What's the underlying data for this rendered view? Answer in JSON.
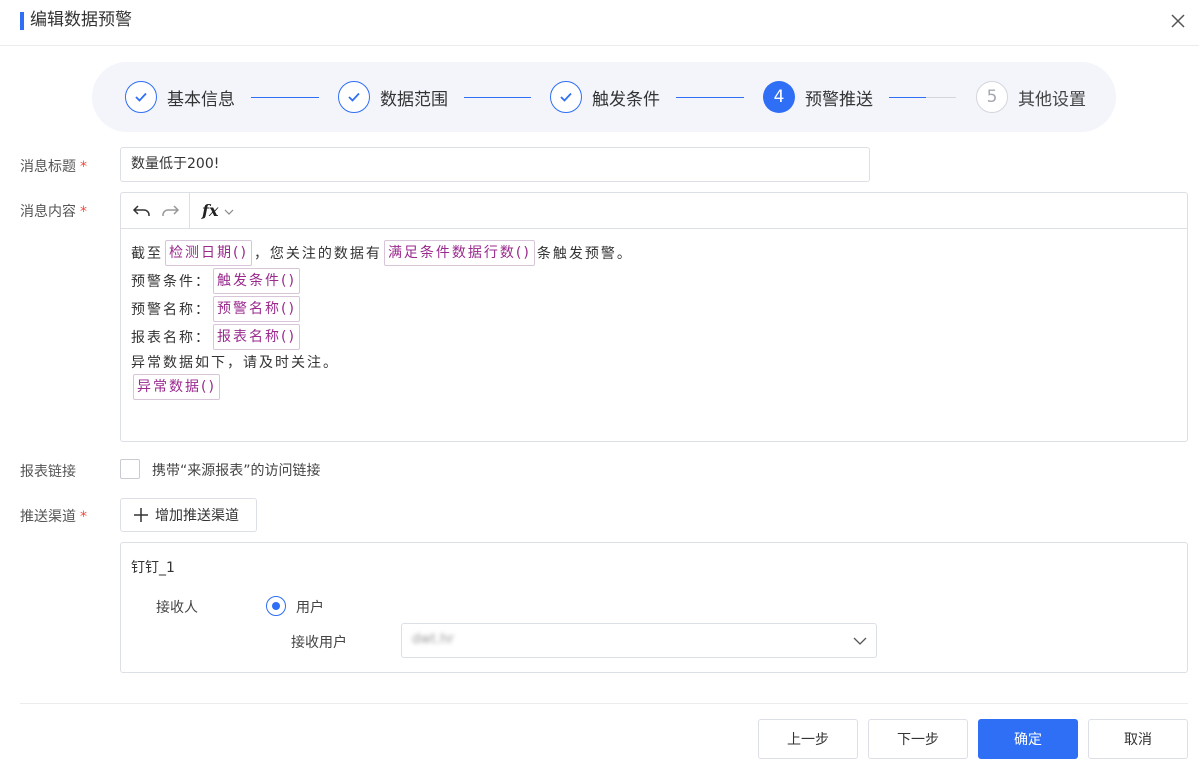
{
  "dialog": {
    "title": "编辑数据预警"
  },
  "steps": [
    {
      "label": "基本信息",
      "state": "done"
    },
    {
      "label": "数据范围",
      "state": "done"
    },
    {
      "label": "触发条件",
      "state": "done"
    },
    {
      "label": "预警推送",
      "state": "active",
      "number": "4"
    },
    {
      "label": "其他设置",
      "state": "todo",
      "number": "5"
    }
  ],
  "form": {
    "title_label": "消息标题",
    "title_value": "数量低于200!",
    "content_label": "消息内容",
    "link_label": "报表链接",
    "link_checkbox_label": "携带“来源报表”的访问链接",
    "link_checked": false,
    "channel_label": "推送渠道",
    "required_mark": "*",
    "add_channel_label": "增加推送渠道"
  },
  "editor": {
    "fx_label": "fx",
    "line1": {
      "prefix": "截至",
      "token1": "检测日期()",
      "mid": "，您关注的数据有",
      "token2": "满足条件数据行数()",
      "suffix": "条触发预警。"
    },
    "line2": {
      "label": "预警条件：",
      "token": "触发条件()"
    },
    "line3": {
      "label": "预警名称：",
      "token": "预警名称()"
    },
    "line4": {
      "label": "报表名称：",
      "token": "报表名称()"
    },
    "line5": "异常数据如下，请及时关注。",
    "line6": {
      "token": "异常数据()"
    }
  },
  "channel": {
    "name": "钉钉_1",
    "receiver_label": "接收人",
    "receiver_option": "用户",
    "receiver_selected": true,
    "receive_user_label": "接收用户",
    "receive_user_value": "dwt.hr"
  },
  "footer": {
    "prev": "上一步",
    "next": "下一步",
    "confirm": "确定",
    "cancel": "取消"
  },
  "colors": {
    "primary": "#2e6ff5",
    "required": "#f5483b",
    "token_text": "#9a2a8e"
  }
}
